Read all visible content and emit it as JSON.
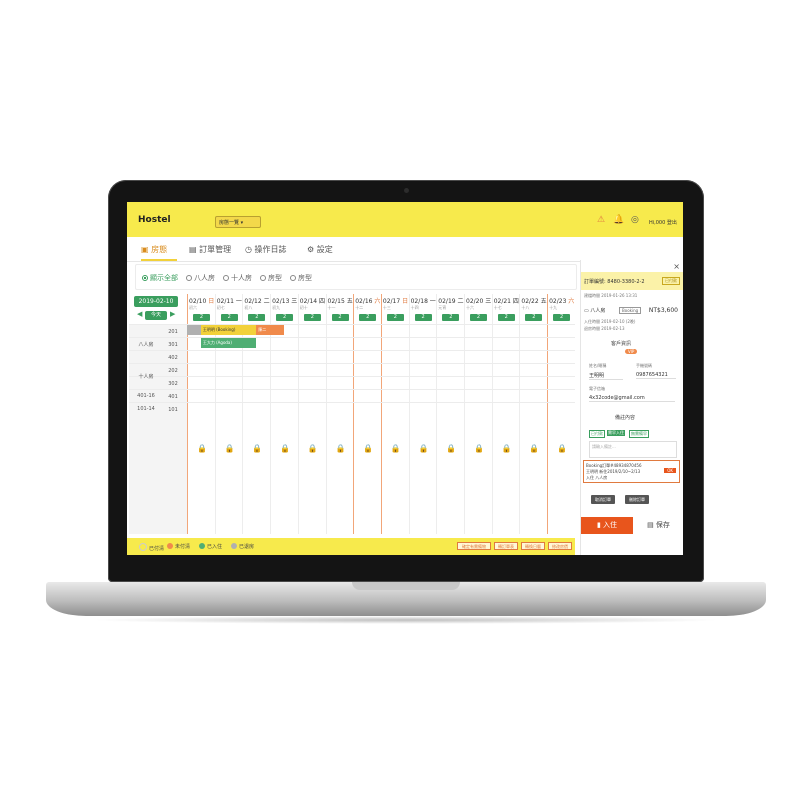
{
  "app": {
    "title": "Hostel",
    "selector_label": "房態一覽 ▾",
    "user_label": "Hi,000  登出"
  },
  "tabs": [
    {
      "label": "房態"
    },
    {
      "label": "訂單管理"
    },
    {
      "label": "操作日誌"
    },
    {
      "label": "設定"
    }
  ],
  "filters": [
    {
      "label": "顯示全部",
      "selected": true
    },
    {
      "label": "八人房",
      "selected": false
    },
    {
      "label": "十人房",
      "selected": false
    },
    {
      "label": "房型",
      "selected": false
    },
    {
      "label": "房型",
      "selected": false
    }
  ],
  "calendar": {
    "current_date": "2019-02-10",
    "today_label": "今天",
    "days": [
      {
        "date": "02/10",
        "weekday": "日",
        "sub": "初六",
        "count": "2",
        "weekend": true
      },
      {
        "date": "02/11",
        "weekday": "一",
        "sub": "初七",
        "count": "2",
        "weekend": false
      },
      {
        "date": "02/12",
        "weekday": "二",
        "sub": "初八",
        "count": "2",
        "weekend": false
      },
      {
        "date": "02/13",
        "weekday": "三",
        "sub": "初九",
        "count": "2",
        "weekend": false
      },
      {
        "date": "02/14",
        "weekday": "四",
        "sub": "初十",
        "count": "2",
        "weekend": false
      },
      {
        "date": "02/15",
        "weekday": "五",
        "sub": "十一",
        "count": "2",
        "weekend": false
      },
      {
        "date": "02/16",
        "weekday": "六",
        "sub": "十二",
        "count": "2",
        "weekend": true
      },
      {
        "date": "02/17",
        "weekday": "日",
        "sub": "十三",
        "count": "2",
        "weekend": true
      },
      {
        "date": "02/18",
        "weekday": "一",
        "sub": "十四",
        "count": "2",
        "weekend": false
      },
      {
        "date": "02/19",
        "weekday": "二",
        "sub": "元宵",
        "count": "2",
        "weekend": false
      },
      {
        "date": "02/20",
        "weekday": "三",
        "sub": "十六",
        "count": "2",
        "weekend": false
      },
      {
        "date": "02/21",
        "weekday": "四",
        "sub": "十七",
        "count": "2",
        "weekend": false
      },
      {
        "date": "02/22",
        "weekday": "五",
        "sub": "十八",
        "count": "2",
        "weekend": false
      },
      {
        "date": "02/23",
        "weekday": "六",
        "sub": "十九",
        "count": "2",
        "weekend": true
      }
    ],
    "room_types": [
      {
        "label": "八人房"
      },
      {
        "label": "十人房"
      },
      {
        "label": "401-16"
      },
      {
        "label": "101-14"
      }
    ],
    "rooms": [
      "201",
      "301",
      "402",
      "202",
      "302",
      "401",
      "101"
    ],
    "bookings": [
      {
        "label": "王明明 (Booking)",
        "color": "#f2d13a"
      },
      {
        "label": "陳二",
        "color": "#f08a4b"
      },
      {
        "label": "王大力 (Agoda)",
        "color": "#4fae73"
      }
    ]
  },
  "legend": [
    {
      "label": "已付清",
      "color": "#f7ea4c"
    },
    {
      "label": "未付清",
      "color": "#f08a4b"
    },
    {
      "label": "已入住",
      "color": "#4fae73"
    },
    {
      "label": "已退房",
      "color": "#b0b0b0"
    }
  ],
  "bottom_buttons": [
    "確定有需備物",
    "轉訂單表",
    "轉換日曆",
    "修改房價"
  ],
  "panel": {
    "close": "×",
    "order_no": "訂單編號: 8480-3380-2-2",
    "order_tag": "已付款",
    "created": "建檔時間 2019-01-26 13:31",
    "room": "八人房",
    "room_tag": "Booking",
    "price": "NT$3,600",
    "checkin": "入住時間 2019-02-10 (2晚)",
    "checkout": "退房時間 2019-02-13",
    "customer_title": "客戶資訊",
    "vip_badge": "VIP",
    "name_label": "姓名/暱稱",
    "name_value": "王明明",
    "phone_label": "手機號碼",
    "phone_value": "0987654321",
    "email_label": "電子信箱",
    "email_value": "4x32code@gmail.com",
    "note_title": "備註內容",
    "note_tags": [
      "已付款",
      "需早入住",
      "無需備早"
    ],
    "note_placeholder": "請輸入備註...",
    "notice_line1": "Booking訂單#48934870456",
    "notice_line2": "王明明 新住2019/2/10~2/13",
    "notice_line3": "入住 八人房",
    "notice_ok": "OK",
    "btn_cancel": "取消訂單",
    "btn_delete": "刪除訂單",
    "btn_checkin": "入住",
    "btn_save": "保存"
  }
}
